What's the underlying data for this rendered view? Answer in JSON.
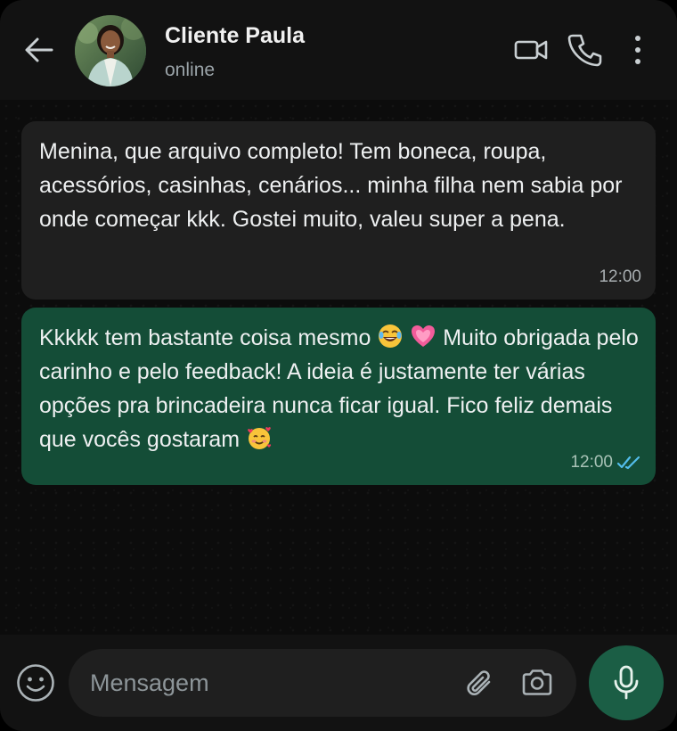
{
  "header": {
    "contact_name": "Cliente Paula",
    "status": "online"
  },
  "messages": [
    {
      "direction": "incoming",
      "text": "Menina, que arquivo completo! Tem boneca, roupa, acessórios, casinhas, cenários... minha filha nem sabia por onde começar kkk. Gostei muito, valeu super a pena.",
      "time": "12:00"
    },
    {
      "direction": "outgoing",
      "text_part1": "Kkkkk tem bastante coisa mesmo ",
      "emoji1": "😂",
      "emoji2": "💗",
      "text_part2": " Muito obrigada pelo carinho e pelo feedback! A ideia é justamente ter várias opções pra brincadeira nunca ficar igual. Fico feliz demais que vocês gostaram ",
      "emoji3": "🥰",
      "time": "12:00",
      "read": true
    }
  ],
  "composer": {
    "placeholder": "Mensagem"
  },
  "colors": {
    "incoming_bubble": "#1f1f1f",
    "outgoing_bubble": "#144d37",
    "mic_button": "#1b5e45",
    "read_ticks": "#53bdeb"
  },
  "icons": [
    "back-arrow-icon",
    "video-call-icon",
    "phone-icon",
    "more-vertical-icon",
    "emoji-icon",
    "paperclip-icon",
    "camera-icon",
    "microphone-icon",
    "double-check-icon"
  ]
}
